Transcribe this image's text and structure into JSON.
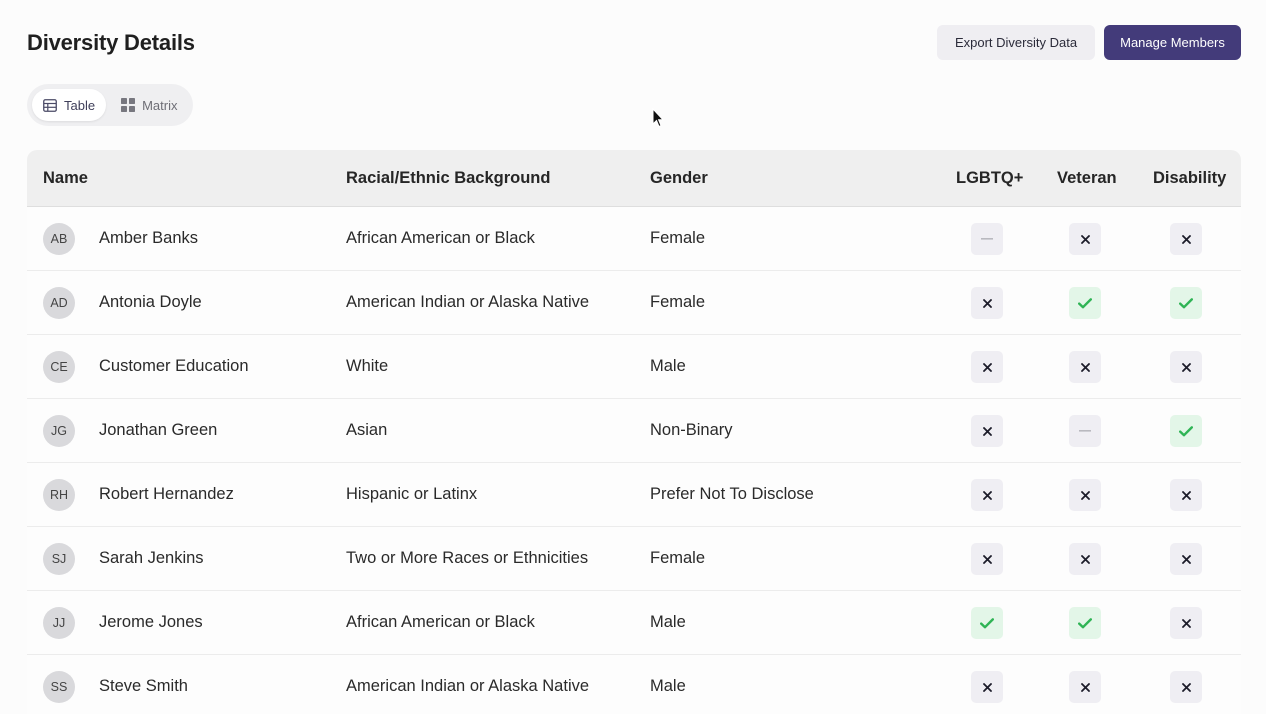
{
  "header": {
    "title": "Diversity Details",
    "export_label": "Export Diversity Data",
    "manage_label": "Manage Members"
  },
  "view_toggle": {
    "options": [
      {
        "label": "Table",
        "icon": "table-icon",
        "active": true
      },
      {
        "label": "Matrix",
        "icon": "grid-icon",
        "active": false
      }
    ]
  },
  "colors": {
    "accent": "#433b7a",
    "yes": "#2fb455",
    "yes_bg": "#e3f6e8",
    "flag_bg": "#efeef3"
  },
  "table": {
    "columns": [
      "Name",
      "Racial/Ethnic Background",
      "Gender",
      "LGBTQ+",
      "Veteran",
      "Disability"
    ],
    "rows": [
      {
        "initials": "AB",
        "name": "Amber Banks",
        "race": "African American or Black",
        "gender": "Female",
        "lgbtq": "na",
        "veteran": "no",
        "disability": "no"
      },
      {
        "initials": "AD",
        "name": "Antonia Doyle",
        "race": "American Indian or Alaska Native",
        "gender": "Female",
        "lgbtq": "no",
        "veteran": "yes",
        "disability": "yes"
      },
      {
        "initials": "CE",
        "name": "Customer Education",
        "race": "White",
        "gender": "Male",
        "lgbtq": "no",
        "veteran": "no",
        "disability": "no"
      },
      {
        "initials": "JG",
        "name": "Jonathan Green",
        "race": "Asian",
        "gender": "Non-Binary",
        "lgbtq": "no",
        "veteran": "na",
        "disability": "yes"
      },
      {
        "initials": "RH",
        "name": "Robert Hernandez",
        "race": "Hispanic or Latinx",
        "gender": "Prefer Not To Disclose",
        "lgbtq": "no",
        "veteran": "no",
        "disability": "no"
      },
      {
        "initials": "SJ",
        "name": "Sarah Jenkins",
        "race": "Two or More Races or Ethnicities",
        "gender": "Female",
        "lgbtq": "no",
        "veteran": "no",
        "disability": "no"
      },
      {
        "initials": "JJ",
        "name": "Jerome Jones",
        "race": "African American or Black",
        "gender": "Male",
        "lgbtq": "yes",
        "veteran": "yes",
        "disability": "no"
      },
      {
        "initials": "SS",
        "name": "Steve Smith",
        "race": "American Indian or Alaska Native",
        "gender": "Male",
        "lgbtq": "no",
        "veteran": "no",
        "disability": "no"
      }
    ]
  }
}
